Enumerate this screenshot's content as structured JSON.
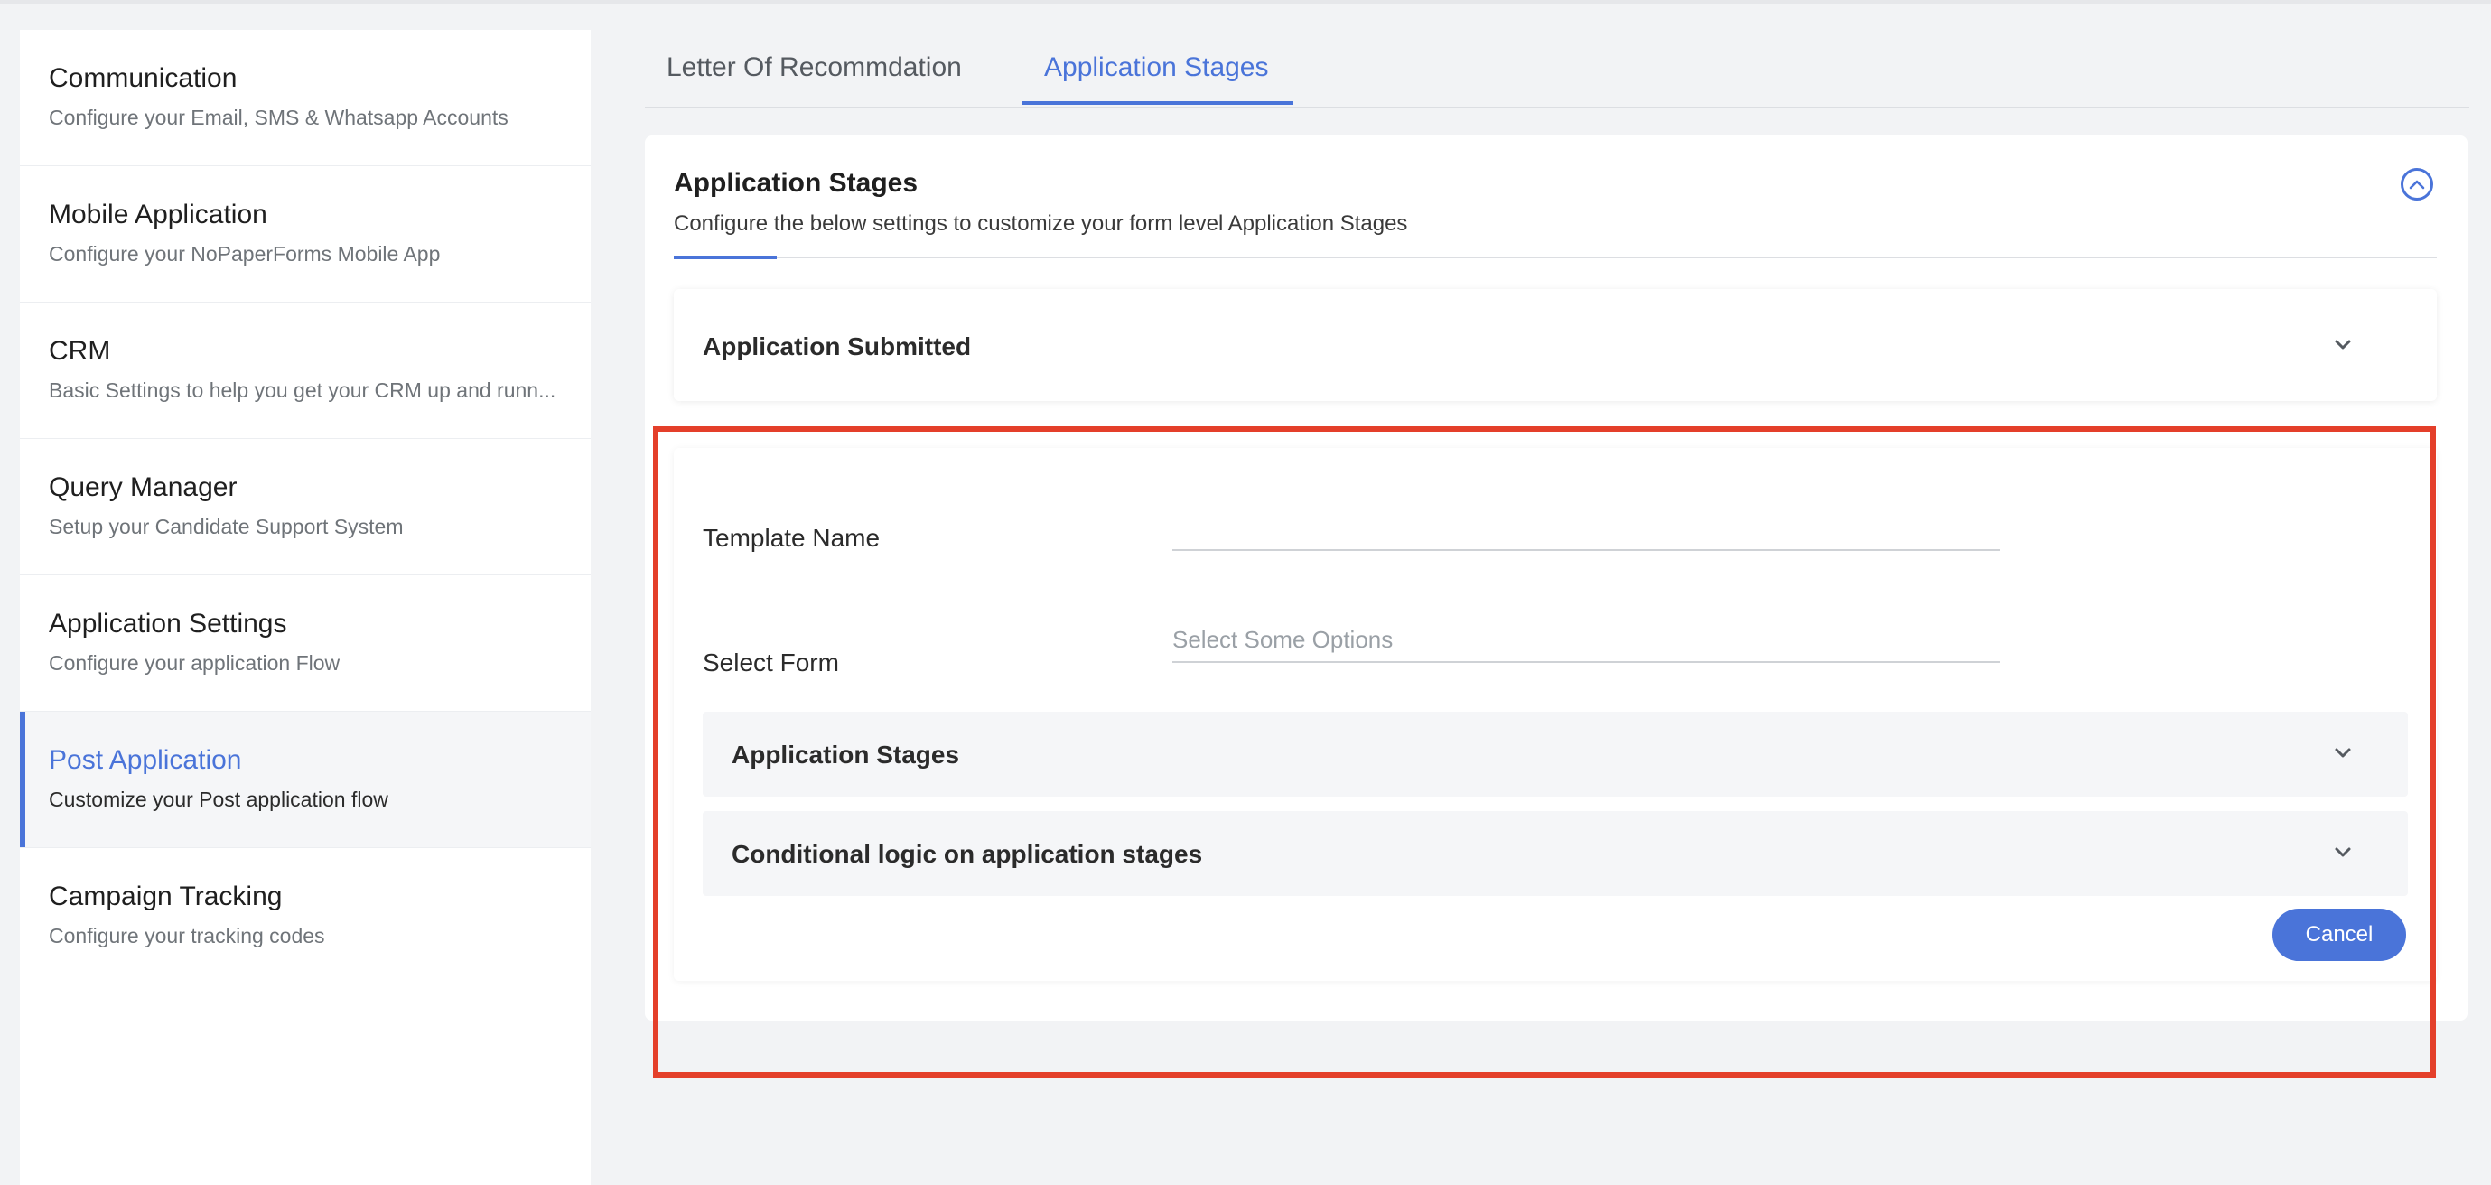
{
  "sidebar": {
    "items": [
      {
        "title": "Communication",
        "subtitle": "Configure your Email, SMS & Whatsapp Accounts"
      },
      {
        "title": "Mobile Application",
        "subtitle": "Configure your NoPaperForms Mobile App"
      },
      {
        "title": "CRM",
        "subtitle": "Basic Settings to help you get your CRM up and runn..."
      },
      {
        "title": "Query Manager",
        "subtitle": "Setup your Candidate Support System"
      },
      {
        "title": "Application Settings",
        "subtitle": "Configure your application Flow"
      },
      {
        "title": "Post Application",
        "subtitle": "Customize your Post application flow",
        "active": true
      },
      {
        "title": "Campaign Tracking",
        "subtitle": "Configure your tracking codes"
      }
    ]
  },
  "tabs": [
    {
      "label": "Letter Of Recommdation"
    },
    {
      "label": "Application Stages",
      "active": true
    }
  ],
  "card": {
    "title": "Application Stages",
    "subtitle": "Configure the below settings to customize your form level Application Stages",
    "submitted_label": "Application Submitted",
    "form": {
      "template_name_label": "Template Name",
      "template_name_value": "",
      "select_form_label": "Select Form",
      "select_form_placeholder": "Select Some Options",
      "accordion_stages": "Application Stages",
      "accordion_conditional": "Conditional logic on application stages",
      "cancel_label": "Cancel"
    }
  },
  "colors": {
    "accent": "#4a74d9",
    "highlight": "#e43f2a",
    "background": "#f2f3f5"
  },
  "icons": {
    "collapse": "chevron-up-circle-icon",
    "expand": "chevron-down-icon"
  }
}
